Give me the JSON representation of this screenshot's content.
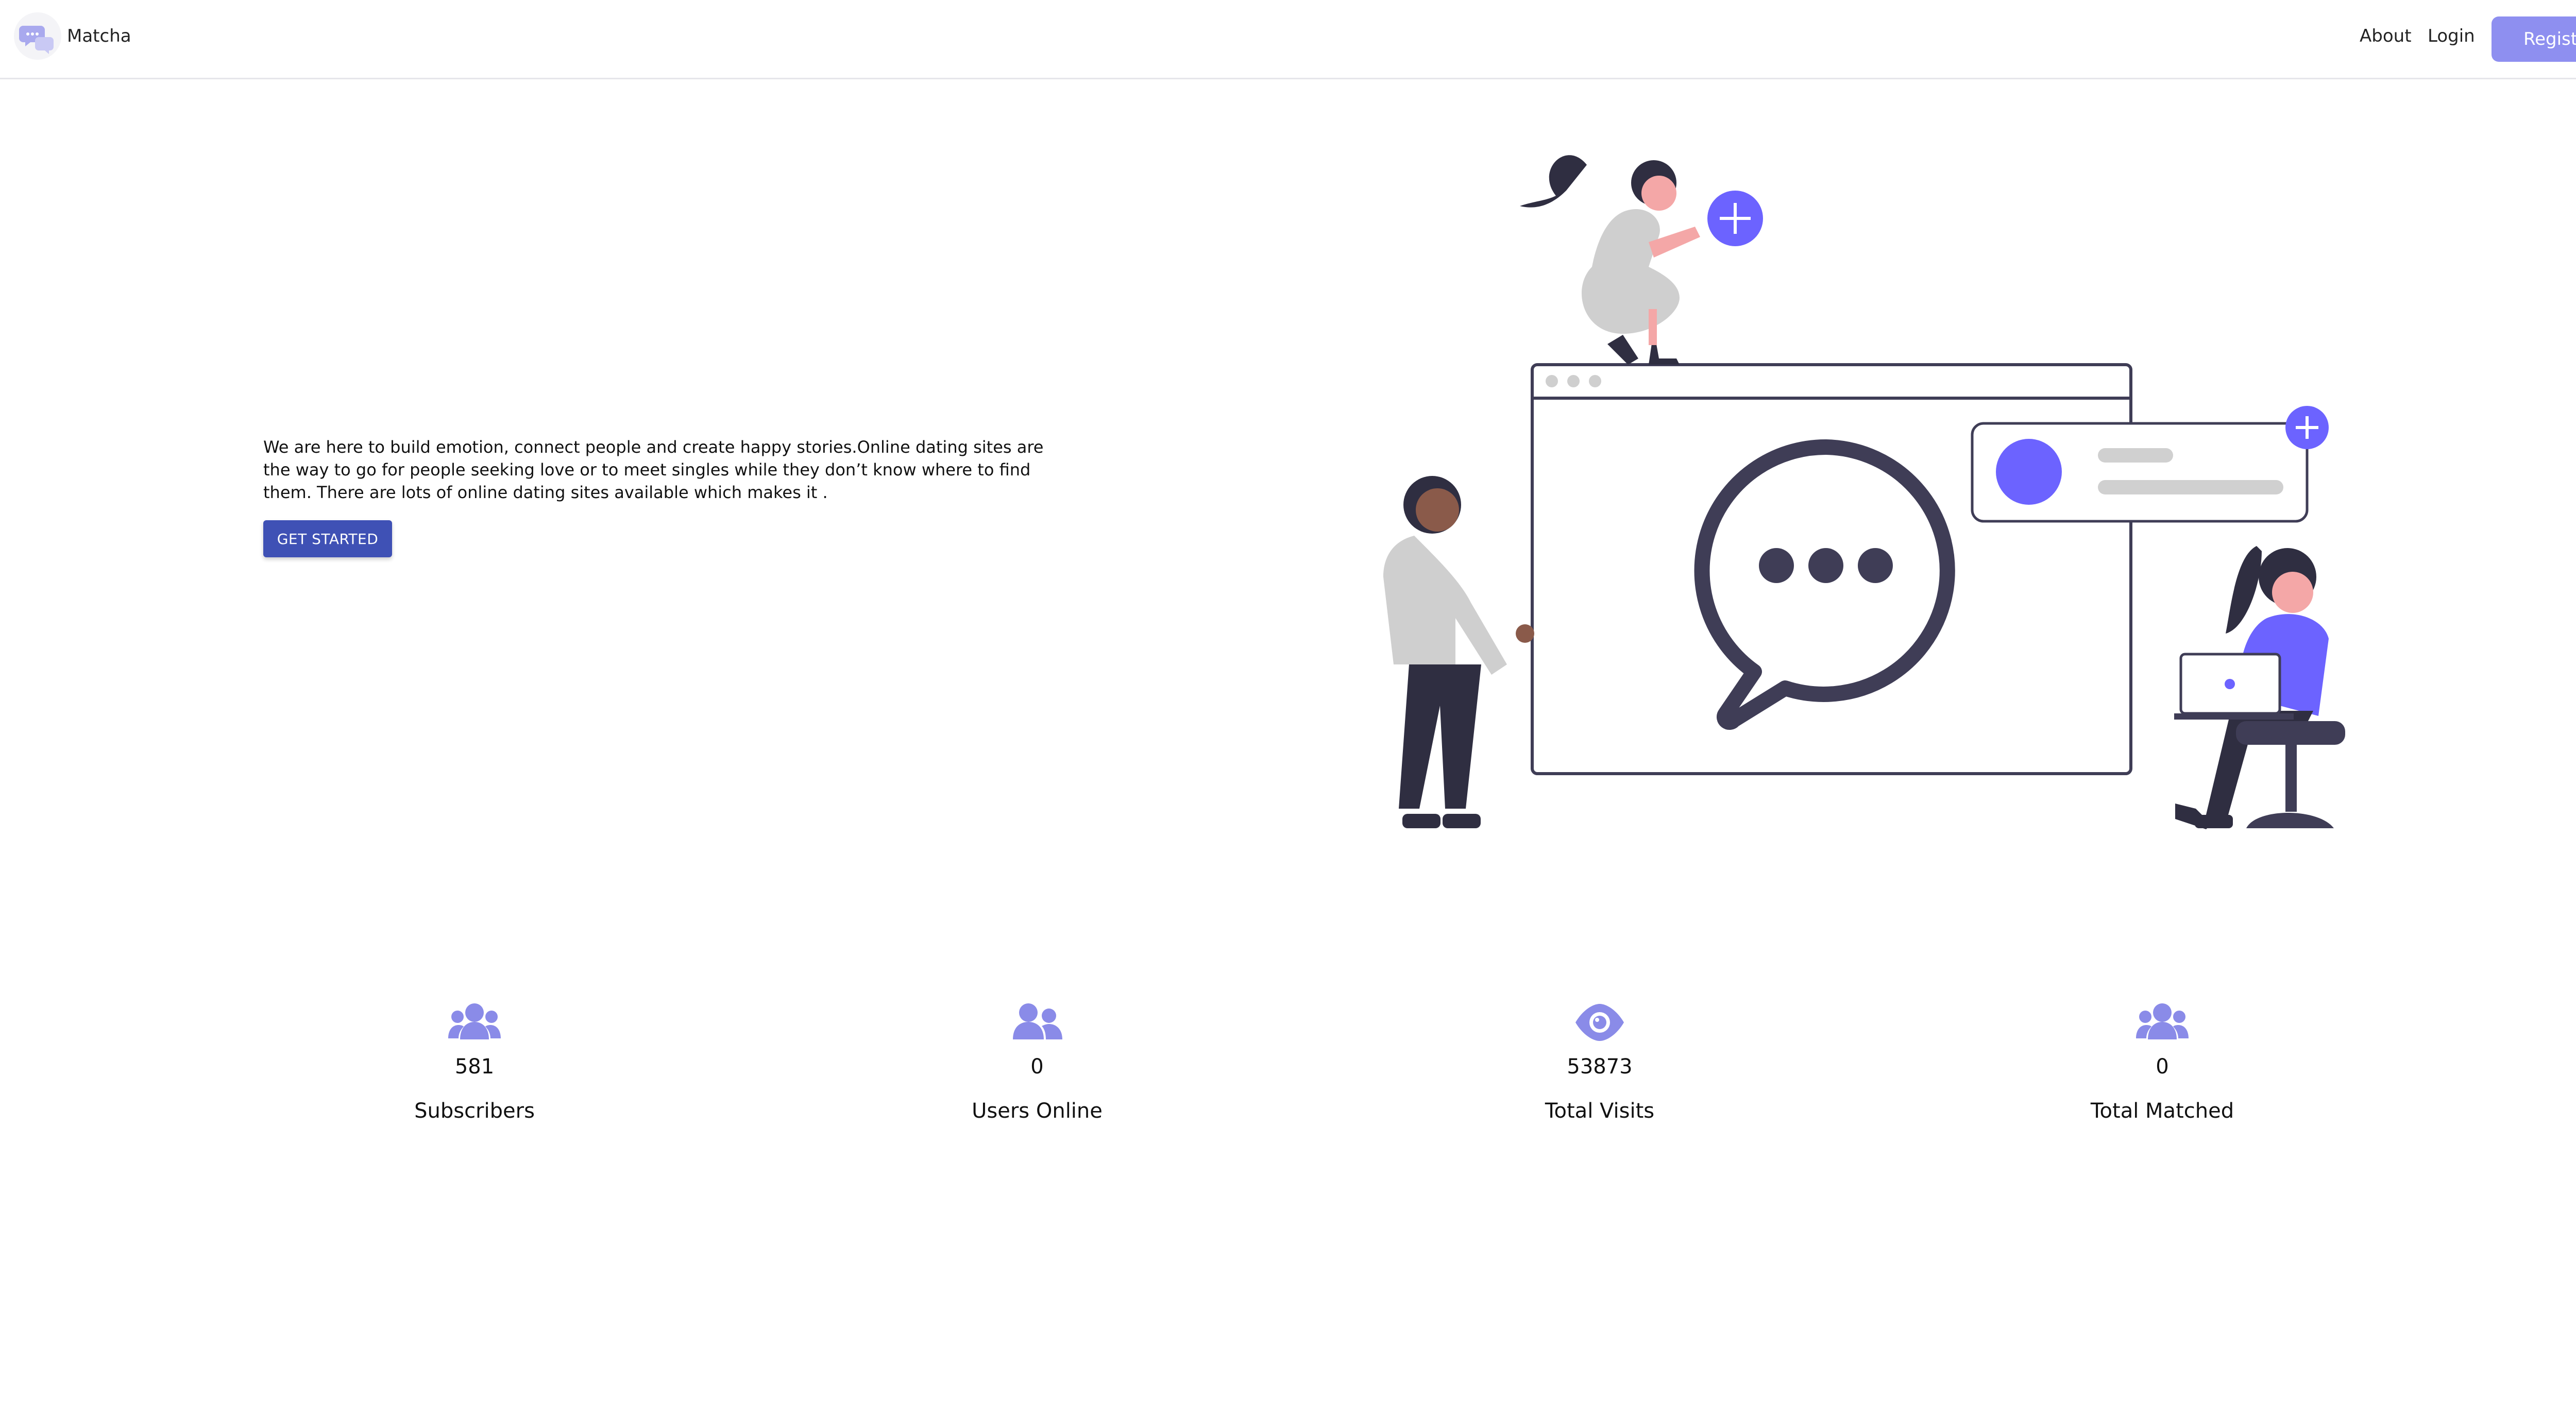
{
  "header": {
    "brand": "Matcha",
    "logo_icon": "chat-bubbles-icon",
    "nav": {
      "about": "About",
      "login": "Login",
      "register": "Register"
    }
  },
  "hero": {
    "description": "We are here to build emotion, connect people and create happy stories.Online dating sites are the way to go for people seeking love or to meet singles while they don’t know where to find them. There are lots of online dating sites available which makes it .",
    "cta_label": "GET STARTED",
    "illustration": "chat-window-people-illustration"
  },
  "stats": [
    {
      "icon": "users-icon",
      "value": "581",
      "label": "Subscribers"
    },
    {
      "icon": "user-friends-icon",
      "value": "0",
      "label": "Users Online"
    },
    {
      "icon": "eye-icon",
      "value": "53873",
      "label": "Total Visits"
    },
    {
      "icon": "users-icon",
      "value": "0",
      "label": "Total Matched"
    }
  ],
  "colors": {
    "accent": "#6c63ff",
    "register_button": "#8e8ff0",
    "cta_button": "#3f51b5",
    "stat_icon": "#8a8be8",
    "dark_figure": "#3f3d56"
  }
}
